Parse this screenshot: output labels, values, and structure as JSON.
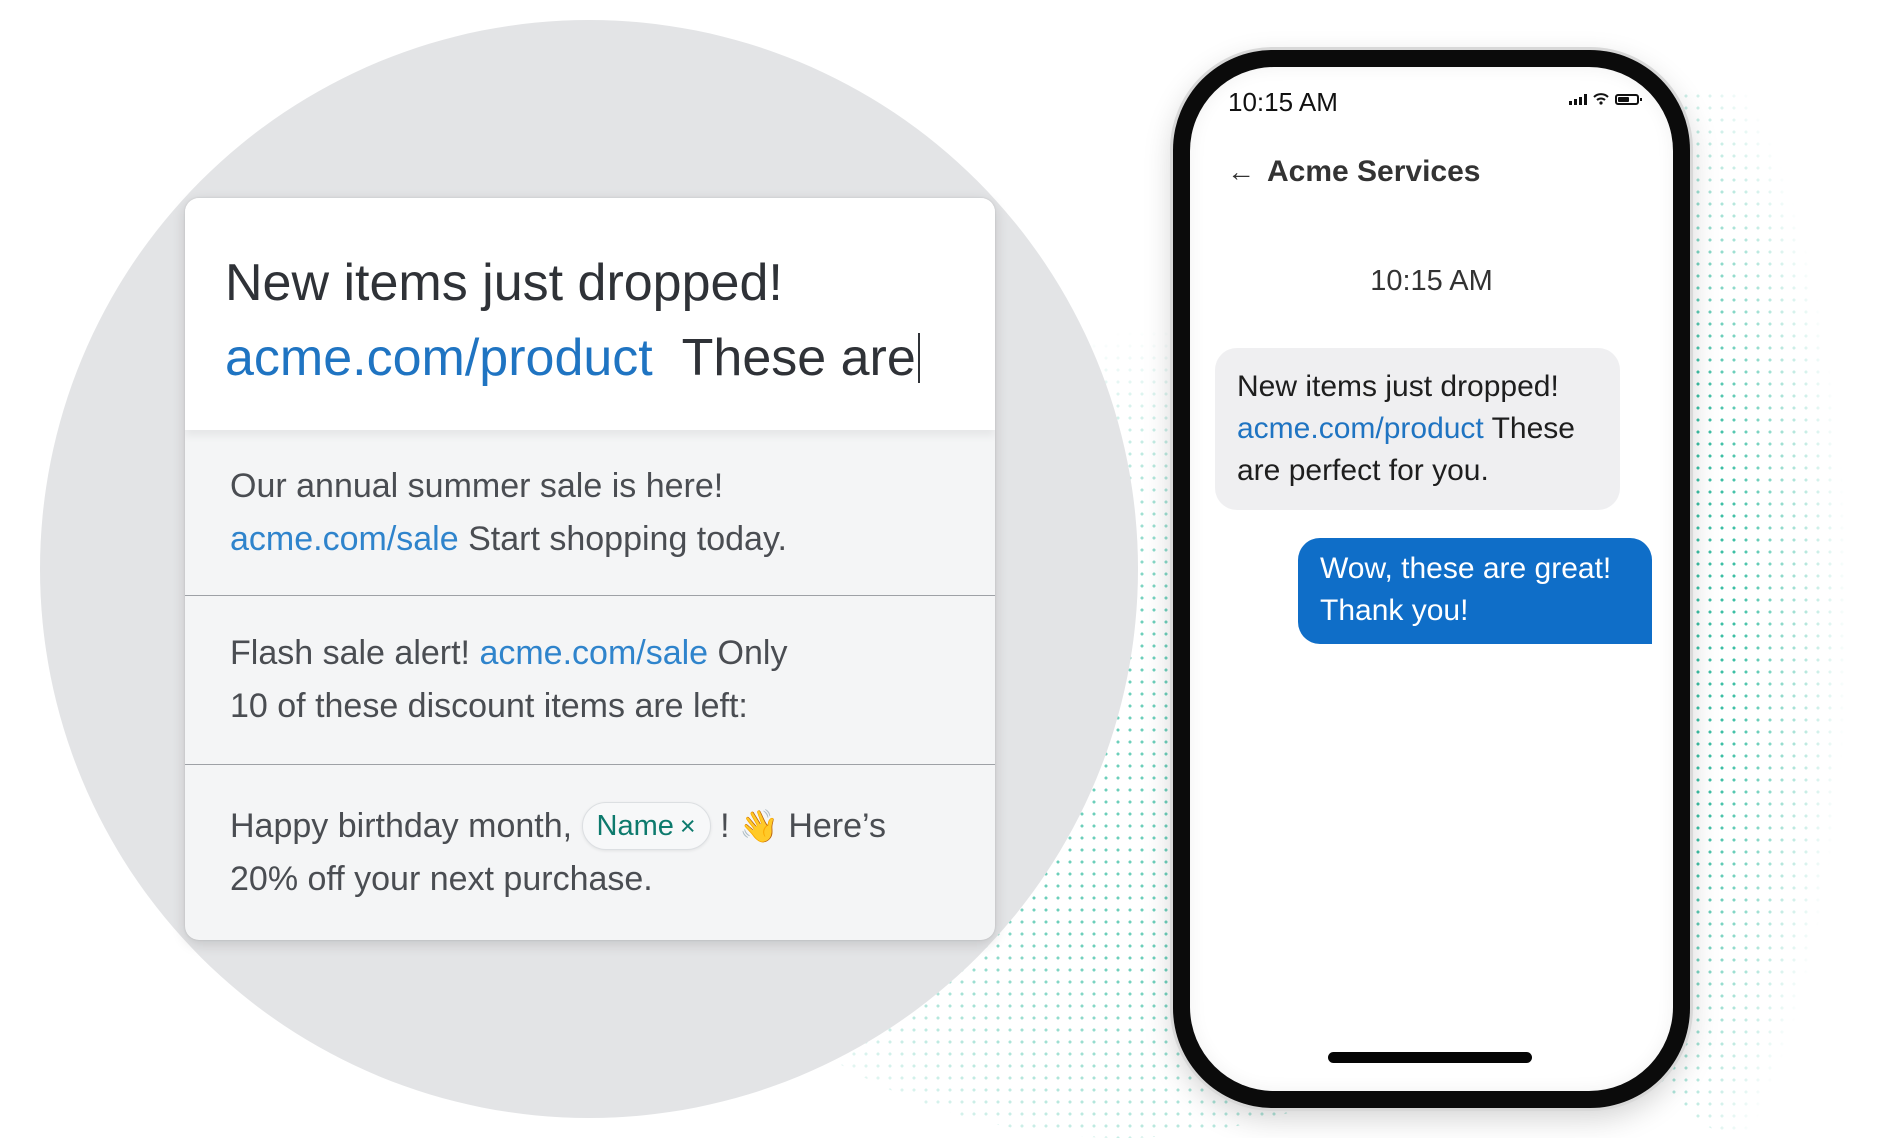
{
  "composer": {
    "line1": "New items just dropped!",
    "link": "acme.com/product",
    "typed_text": "These are"
  },
  "templates": [
    {
      "before": "Our annual summer sale is here!",
      "link": "acme.com/sale",
      "after": "Start shopping today."
    },
    {
      "before": "Flash sale alert!",
      "link": "acme.com/sale",
      "after": "Only 10 of these discount items are left:"
    },
    {
      "before": "Happy birthday month,",
      "chip_label": "Name",
      "chip_remove": "×",
      "punct": "!",
      "emoji": "👋",
      "after": "Here’s 20% off your next purchase."
    }
  ],
  "phone": {
    "status_time": "10:15 AM",
    "status_icons": [
      "signal-icon",
      "wifi-icon",
      "battery-icon"
    ],
    "back_icon": "←",
    "contact_name": "Acme Services",
    "timestamp": "10:15 AM",
    "incoming": {
      "before": "New items just dropped!",
      "link": "acme.com/product",
      "after": "These are perfect for you."
    },
    "outgoing": "Wow, these are great! Thank you!"
  },
  "colors": {
    "link": "#1f74c2",
    "outgoing_bubble": "#0f6ec8",
    "chip_text": "#0d7a6d",
    "dots": "#3cbfa4"
  }
}
